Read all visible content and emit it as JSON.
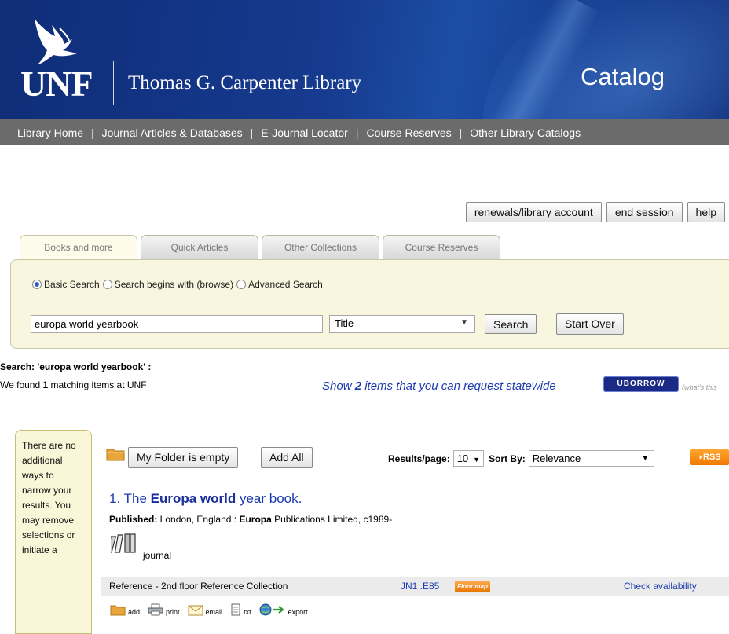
{
  "header": {
    "logo_text": "UNF",
    "library_name": "Thomas G. Carpenter Library",
    "section_title": "Catalog"
  },
  "nav": {
    "items": [
      "Library Home",
      "Journal Articles & Databases",
      "E-Journal Locator",
      "Course Reserves",
      "Other Library Catalogs"
    ],
    "separator": "|"
  },
  "account_buttons": {
    "renewals": "renewals/library account",
    "end_session": "end session",
    "help": "help"
  },
  "tabs": [
    "Books and more",
    "Quick Articles",
    "Other Collections",
    "Course Reserves"
  ],
  "search": {
    "types": [
      {
        "label": "Basic Search",
        "checked": true
      },
      {
        "label": "Search begins with (browse)",
        "checked": false
      },
      {
        "label": "Advanced Search",
        "checked": false
      }
    ],
    "query": "europa world yearbook",
    "field": "Title",
    "search_button": "Search",
    "start_over_button": "Start Over"
  },
  "results_summary": {
    "search_line": "Search: 'europa world yearbook' :",
    "found_prefix": "We found ",
    "found_count": "1",
    "found_suffix": " matching items at UNF",
    "statewide_prefix": "Show ",
    "statewide_count": "2",
    "statewide_suffix": " items that you can request statewide",
    "uborrow": "UBORROW",
    "whats_this": "(what's this"
  },
  "sidebar": {
    "text": "There are no additional ways to narrow your results. You may remove selections or initiate a"
  },
  "folder": {
    "my_folder_label": "My Folder is empty",
    "add_all_label": "Add All",
    "results_per_page_label": "Results/page:",
    "results_per_page_value": "10",
    "sort_by_label": "Sort By:",
    "sort_by_value": "Relevance",
    "rss_label": "RSS"
  },
  "result": {
    "number": "1.",
    "title_pre": " The ",
    "title_bold": "Europa world",
    "title_post": " year book.",
    "published_label": "Published:",
    "published_pre": " London, England : ",
    "published_bold": "Europa",
    "published_post": " Publications Limited, c1989-",
    "format": "journal",
    "location": "Reference - 2nd floor Reference Collection",
    "call_number": "JN1 .E85",
    "floor_map": "Floor map",
    "check_availability": "Check availability",
    "actions": [
      "add",
      "print",
      "email",
      "txt",
      "export"
    ]
  },
  "icons": {
    "folder": "folder-icon",
    "journal": "journal-icon",
    "print": "printer-icon",
    "email": "envelope-icon",
    "txt": "document-icon",
    "export": "globe-arrow-icon"
  },
  "colors": {
    "header_blue": "#163a8e",
    "nav_gray": "#6b6b6b",
    "panel_cream": "#f9f6df",
    "link_blue": "#1c3bb0",
    "rss_orange": "#f07800"
  }
}
